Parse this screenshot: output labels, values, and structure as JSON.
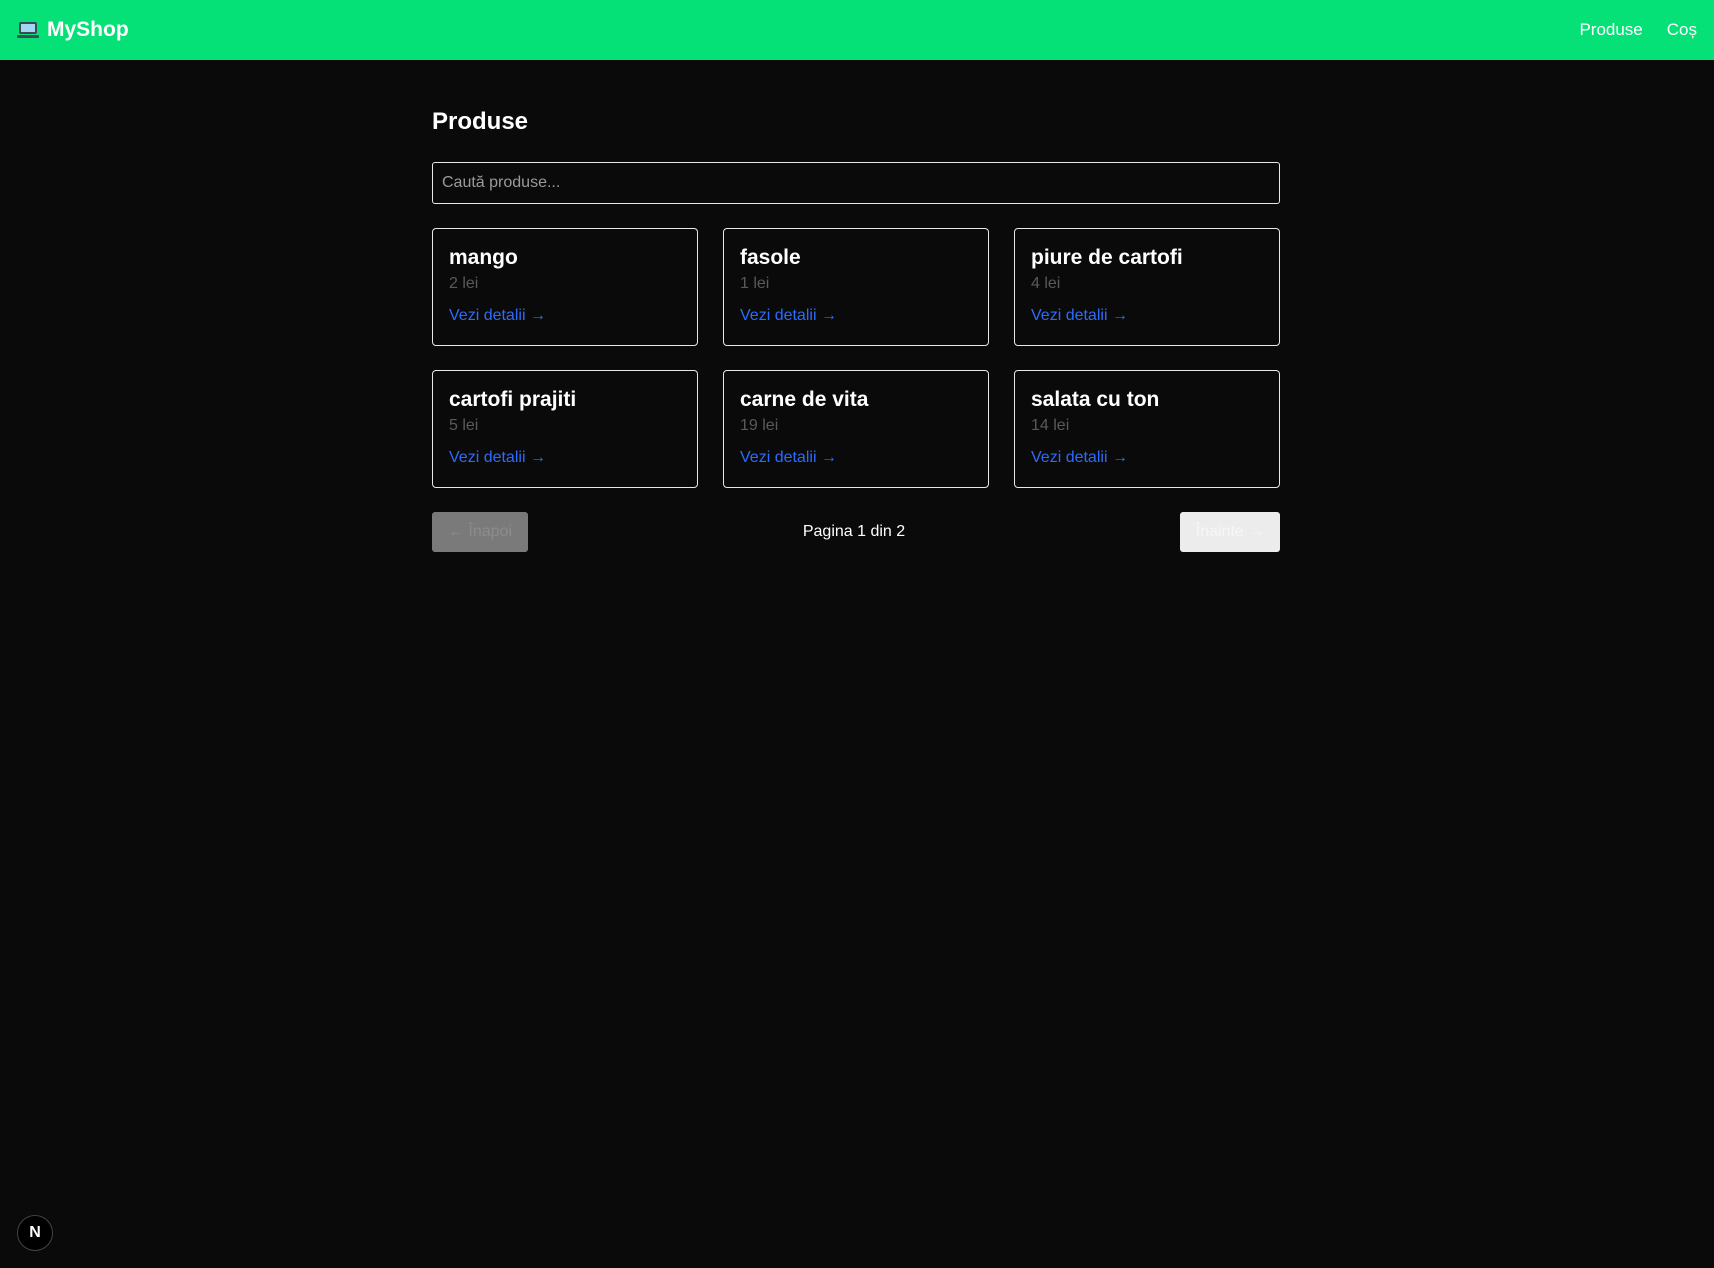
{
  "header": {
    "brand_icon": "laptop-icon",
    "brand": "MyShop",
    "nav": [
      "Produse",
      "Coș"
    ]
  },
  "main": {
    "title": "Produse",
    "search": {
      "placeholder": "Caută produse...",
      "value": ""
    },
    "products": [
      {
        "name": "mango",
        "price": "2 lei",
        "link": "Vezi detalii →"
      },
      {
        "name": "fasole",
        "price": "1 lei",
        "link": "Vezi detalii →"
      },
      {
        "name": "piure de cartofi",
        "price": "4 lei",
        "link": "Vezi detalii →"
      },
      {
        "name": "cartofi prajiti",
        "price": "5 lei",
        "link": "Vezi detalii →"
      },
      {
        "name": "carne de vita",
        "price": "19 lei",
        "link": "Vezi detalii →"
      },
      {
        "name": "salata cu ton",
        "price": "14 lei",
        "link": "Vezi detalii →"
      }
    ],
    "pagination": {
      "prev": "← Înapoi",
      "info": "Pagina 1 din 2",
      "next": "Înainte →"
    }
  },
  "dev_badge": {
    "icon": "nextjs-icon",
    "label": "N"
  },
  "colors": {
    "header_bg": "#05e077",
    "page_bg": "#0a0a0a",
    "link": "#2b6cff",
    "card_border": "#e8e8e8"
  }
}
